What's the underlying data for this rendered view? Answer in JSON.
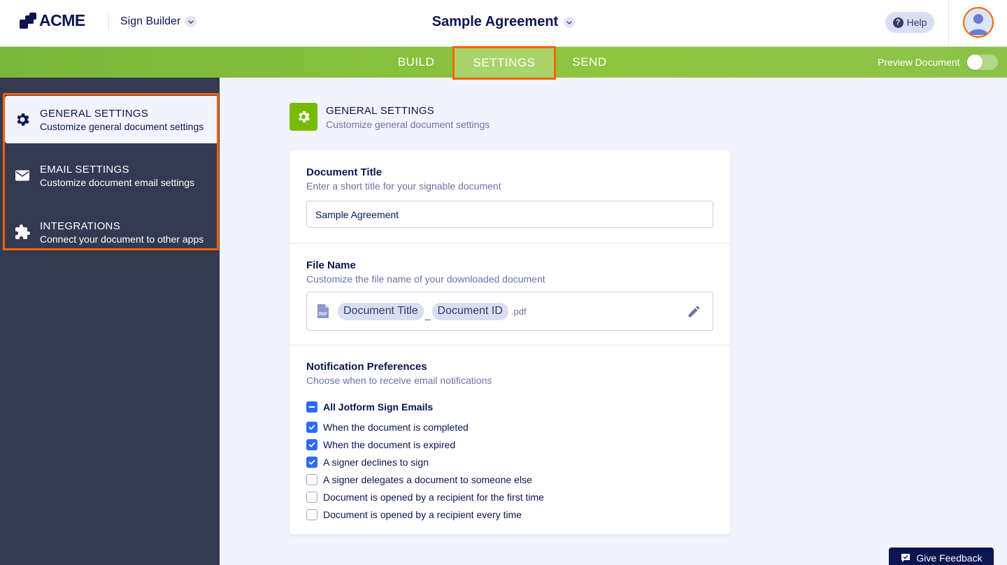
{
  "header": {
    "logo_text": "ACME",
    "product_label": "Sign Builder",
    "document_title": "Sample Agreement",
    "help_label": "Help",
    "help_icon_glyph": "?"
  },
  "nav": {
    "tabs": [
      {
        "label": "BUILD"
      },
      {
        "label": "SETTINGS",
        "active": true
      },
      {
        "label": "SEND"
      }
    ],
    "preview_label": "Preview Document",
    "preview_enabled": false
  },
  "sidebar": {
    "items": [
      {
        "title": "GENERAL SETTINGS",
        "subtitle": "Customize general document settings",
        "icon": "gear-icon",
        "active": true
      },
      {
        "title": "EMAIL SETTINGS",
        "subtitle": "Customize document email settings",
        "icon": "envelope-icon"
      },
      {
        "title": "INTEGRATIONS",
        "subtitle": "Connect your document to other apps",
        "icon": "puzzle-icon"
      }
    ]
  },
  "section": {
    "title": "GENERAL SETTINGS",
    "subtitle": "Customize general document settings",
    "icon": "gear-icon"
  },
  "document_title_field": {
    "label": "Document Title",
    "description": "Enter a short title for your signable document",
    "value": "Sample Agreement"
  },
  "file_name_field": {
    "label": "File Name",
    "description": "Customize the file name of your downloaded document",
    "tokens": [
      "Document Title",
      "Document ID"
    ],
    "separator": "_",
    "extension": ".pdf"
  },
  "notifications": {
    "label": "Notification Preferences",
    "description": "Choose when to receive email notifications",
    "all_label": "All Jotform Sign Emails",
    "all_state": "indeterminate",
    "options": [
      {
        "label": "When the document is completed",
        "checked": true
      },
      {
        "label": "When the document is expired",
        "checked": true
      },
      {
        "label": "A signer declines to sign",
        "checked": true
      },
      {
        "label": "A signer delegates a document to someone else",
        "checked": false
      },
      {
        "label": "Document is opened by a recipient for the first time",
        "checked": false
      },
      {
        "label": "Document is opened by a recipient every time",
        "checked": false
      }
    ]
  },
  "feedback": {
    "label": "Give Feedback"
  },
  "colors": {
    "nav_green": "#8dc63f",
    "sidebar_bg": "#343a52",
    "highlight_orange": "#ff6100",
    "checkbox_blue": "#2e69ff",
    "navy": "#0a1551"
  }
}
